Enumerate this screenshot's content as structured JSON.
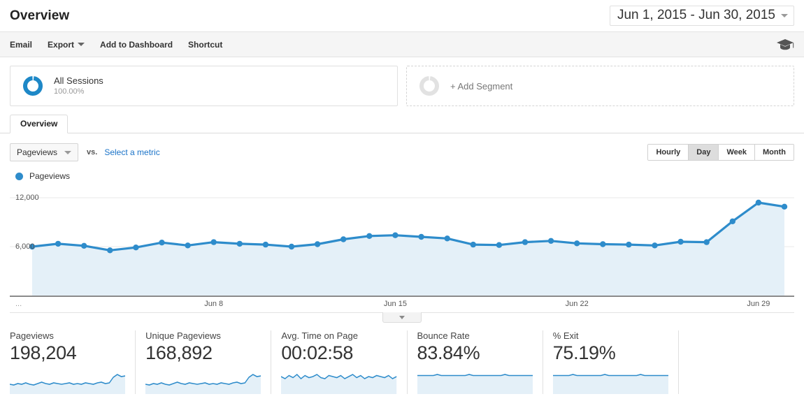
{
  "header": {
    "title": "Overview",
    "date_range": "Jun 1, 2015 - Jun 30, 2015",
    "date_caret_icon": "chevron-down-icon"
  },
  "toolbar": {
    "items": [
      {
        "label": "Email",
        "has_caret": false
      },
      {
        "label": "Export",
        "has_caret": true
      },
      {
        "label": "Add to Dashboard",
        "has_caret": false
      },
      {
        "label": "Shortcut",
        "has_caret": false
      }
    ],
    "help_icon": "graduation-cap-icon"
  },
  "segments": {
    "active": {
      "icon": "donut-icon",
      "name": "All Sessions",
      "percent": "100.00%"
    },
    "add": {
      "icon": "donut-empty-icon",
      "label": "+ Add Segment"
    }
  },
  "tabs": [
    {
      "label": "Overview",
      "active": true
    }
  ],
  "controls": {
    "metric_label": "Pageviews",
    "metric_caret_icon": "chevron-down-icon",
    "vs_label": "vs.",
    "select_metric_label": "Select a metric",
    "granularity": [
      {
        "label": "Hourly",
        "active": false
      },
      {
        "label": "Day",
        "active": true
      },
      {
        "label": "Week",
        "active": false
      },
      {
        "label": "Month",
        "active": false
      }
    ]
  },
  "legend": {
    "label": "Pageviews",
    "color": "#2e8ccb"
  },
  "colors": {
    "line": "#2e8ccb",
    "area": "#e4f0f8",
    "link": "#1a73c8",
    "accent": "#2186c4"
  },
  "chart_data": {
    "type": "line",
    "title": "Pageviews",
    "xlabel": "",
    "ylabel": "Pageviews",
    "grid": true,
    "legend_position": "top-left",
    "ylim": [
      0,
      12000
    ],
    "ytick_labels": [
      "12,000",
      "6,000"
    ],
    "yticks": [
      12000,
      6000
    ],
    "xtick_labels": [
      "...",
      "Jun 8",
      "Jun 15",
      "Jun 22",
      "Jun 29"
    ],
    "xtick_indices": [
      0,
      7,
      14,
      21,
      28
    ],
    "x": [
      "Jun 1",
      "Jun 2",
      "Jun 3",
      "Jun 4",
      "Jun 5",
      "Jun 6",
      "Jun 7",
      "Jun 8",
      "Jun 9",
      "Jun 10",
      "Jun 11",
      "Jun 12",
      "Jun 13",
      "Jun 14",
      "Jun 15",
      "Jun 16",
      "Jun 17",
      "Jun 18",
      "Jun 19",
      "Jun 20",
      "Jun 21",
      "Jun 22",
      "Jun 23",
      "Jun 24",
      "Jun 25",
      "Jun 26",
      "Jun 27",
      "Jun 28",
      "Jun 29",
      "Jun 30"
    ],
    "series": [
      {
        "name": "Pageviews",
        "color": "#2e8ccb",
        "values": [
          6000,
          6350,
          6100,
          5550,
          5900,
          6500,
          6150,
          6550,
          6350,
          6250,
          6000,
          6300,
          6900,
          7300,
          7400,
          7200,
          7000,
          6250,
          6200,
          6550,
          6700,
          6400,
          6300,
          6250,
          6150,
          6600,
          6550,
          9100,
          11400,
          10900
        ]
      }
    ]
  },
  "metric_cards": [
    {
      "title": "Pageviews",
      "value": "198,204",
      "spark": "flat-rising"
    },
    {
      "title": "Unique Pageviews",
      "value": "168,892",
      "spark": "flat-rising"
    },
    {
      "title": "Avg. Time on Page",
      "value": "00:02:58",
      "spark": "flat-wavy"
    },
    {
      "title": "Bounce Rate",
      "value": "83.84%",
      "spark": "flat"
    },
    {
      "title": "% Exit",
      "value": "75.19%",
      "spark": "flat"
    }
  ]
}
